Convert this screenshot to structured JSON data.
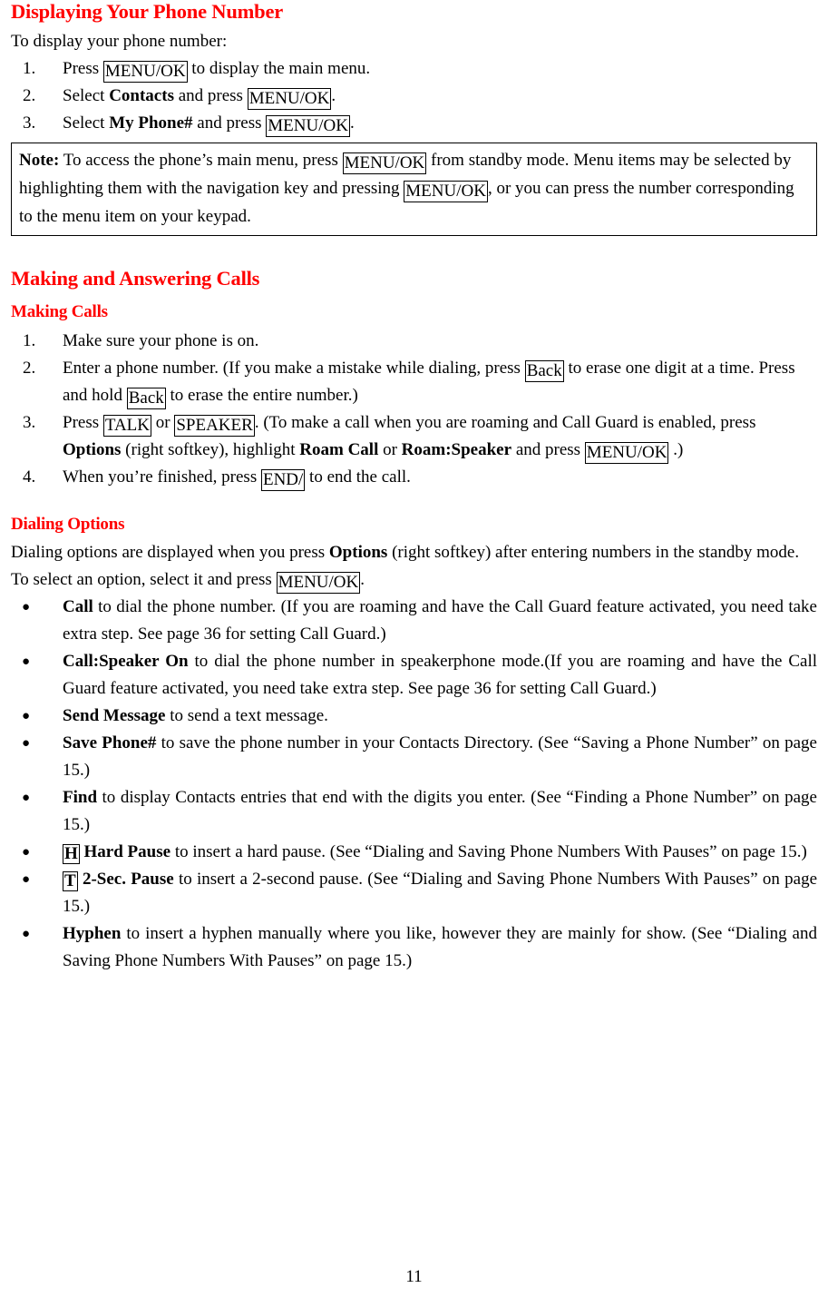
{
  "document": {
    "page_number": "11",
    "heading_color": "#ff0000",
    "body_color": "#000000"
  },
  "section_display": {
    "heading": "Displaying Your Phone Number",
    "intro": "To display your phone number:",
    "steps": [
      {
        "marker": "1.",
        "pre": "Press ",
        "key": "MENU/OK",
        "post": " to display the main menu."
      },
      {
        "marker": "2.",
        "pre": "Select ",
        "bold": "Contacts",
        "mid": " and press ",
        "key": "MENU/OK",
        "post": "."
      },
      {
        "marker": "3.",
        "pre": "Select ",
        "bold": "My Phone#",
        "mid": " and press ",
        "key": "MENU/OK",
        "post": "."
      }
    ],
    "note": {
      "label": "Note:",
      "text_1": " To access the phone’s main menu, press ",
      "key_1": "MENU/OK",
      "text_2": " from standby mode. Menu items may be selected by highlighting them with the navigation key and pressing ",
      "key_2": "MENU/OK",
      "text_3": ", or you can press the number corresponding to the menu item on your keypad."
    }
  },
  "section_making": {
    "heading": "Making and Answering Calls",
    "subheading": "Making Calls",
    "steps": [
      {
        "marker": "1.",
        "text": "Make sure your phone is on."
      },
      {
        "marker": "2.",
        "pre": "Enter a phone number. (If you make a mistake while dialing, press ",
        "key_1": "Back",
        "mid": " to erase one digit at a time. Press and hold ",
        "key_2": "Back",
        "post": " to erase the entire number.)"
      },
      {
        "marker": "3.",
        "pre": "Press ",
        "key_1": "TALK",
        "mid_1": " or ",
        "key_2": "SPEAKER",
        "mid_2": ". (To make a call when you are roaming and Call Guard is enabled, press ",
        "bold_1": "Options",
        "mid_3": " (right softkey), highlight ",
        "bold_2": "Roam Call",
        "mid_4": " or ",
        "bold_3": "Roam:Speaker",
        "mid_5": " and press ",
        "key_3": "MENU/OK",
        "post": " .)"
      },
      {
        "marker": "4.",
        "pre": "When you’re finished, press ",
        "key": "END/",
        "post": " to end the call."
      }
    ]
  },
  "section_dialing": {
    "heading": "Dialing Options",
    "intro_1_pre": "Dialing options are displayed when you press ",
    "intro_1_bold": "Options",
    "intro_1_post": " (right softkey) after entering numbers in the standby mode.",
    "intro_2_pre": "To select an option, select it and press ",
    "intro_2_key": "MENU/OK",
    "intro_2_post": ".",
    "bullet_char": "●",
    "options": [
      {
        "bold": "Call",
        "text": " to dial the phone number. (If you are roaming and have the Call Guard feature activated, you need take extra step. See page 36 for setting Call Guard.)"
      },
      {
        "bold": "Call:Speaker On",
        "text": " to dial the phone number in speakerphone mode.(If you are roaming and have the Call Guard feature activated, you need take extra step. See page 36 for setting Call Guard.)"
      },
      {
        "bold": "Send Message",
        "text": " to send a text message."
      },
      {
        "bold": "Save Phone#",
        "text": " to save the phone number in your Contacts Directory. (See “Saving a Phone Number” on page 15.)"
      },
      {
        "bold": "Find",
        "text": " to display Contacts entries that end with the digits you enter. (See “Finding a Phone Number” on page 15.)"
      },
      {
        "boxed_key": "H",
        "bold": " Hard Pause",
        "text": " to insert a hard pause. (See “Dialing and Saving Phone Numbers With Pauses” on page 15.)"
      },
      {
        "boxed_key": "T",
        "bold": " 2-Sec. Pause",
        "text": " to insert a 2-second pause. (See “Dialing and Saving Phone Numbers With Pauses” on page 15.)"
      },
      {
        "bold": "Hyphen",
        "text": " to insert a hyphen manually where you like, however they are mainly for show. (See “Dialing and Saving Phone Numbers With Pauses” on page 15.)"
      }
    ]
  }
}
